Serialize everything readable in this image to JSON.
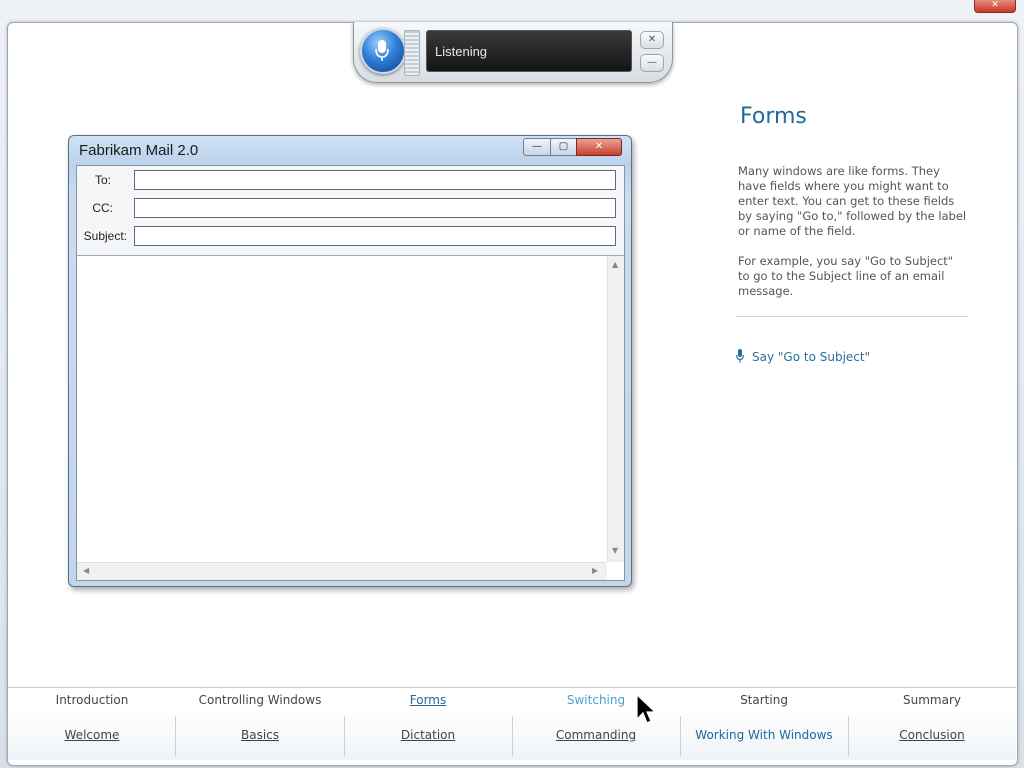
{
  "window": {
    "close_label": "✕"
  },
  "speech_bar": {
    "status": "Listening",
    "close_glyph": "✕",
    "minimize_glyph": "—"
  },
  "mail_window": {
    "title": "Fabrikam Mail 2.0",
    "minimize_glyph": "—",
    "maximize_glyph": "▢",
    "close_glyph": "✕",
    "fields": [
      {
        "label": "To:",
        "value": ""
      },
      {
        "label": "CC:",
        "value": ""
      },
      {
        "label": "Subject:",
        "value": ""
      }
    ],
    "body_text": ""
  },
  "pane": {
    "title": "Forms",
    "paragraph1": "Many windows are like forms. They have fields where you might want to enter text. You can get to these fields by saying \"Go to,\" followed by the label or name of the field.",
    "paragraph2": "For example, you say \"Go to Subject\" to go to the Subject line of an email message.",
    "say_command": "Say \"Go to Subject\""
  },
  "nav_sub": [
    {
      "label": "Introduction",
      "state": "normal"
    },
    {
      "label": "Controlling Windows",
      "state": "normal"
    },
    {
      "label": "Forms",
      "state": "current"
    },
    {
      "label": "Switching",
      "state": "hover"
    },
    {
      "label": "Starting",
      "state": "normal"
    },
    {
      "label": "Summary",
      "state": "normal"
    }
  ],
  "nav_main": [
    {
      "label": "Welcome",
      "state": "normal"
    },
    {
      "label": "Basics",
      "state": "normal"
    },
    {
      "label": "Dictation",
      "state": "normal"
    },
    {
      "label": "Commanding",
      "state": "normal"
    },
    {
      "label": "Working With Windows",
      "state": "current"
    },
    {
      "label": "Conclusion",
      "state": "normal"
    }
  ],
  "colors": {
    "accent": "#1e6b9b",
    "hover": "#4a9fd0",
    "text": "#444444"
  }
}
